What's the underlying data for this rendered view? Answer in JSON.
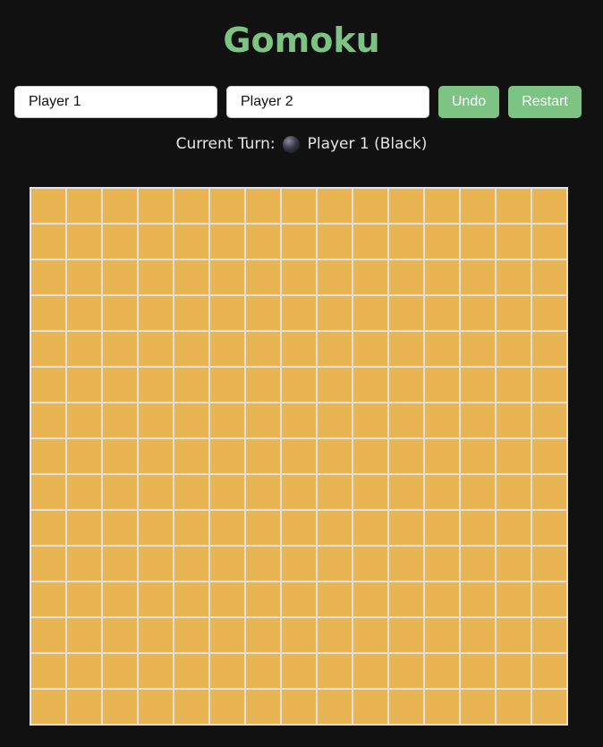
{
  "title": "Gomoku",
  "players": {
    "player1": {
      "value": "Player 1"
    },
    "player2": {
      "value": "Player 2"
    }
  },
  "buttons": {
    "undo": "Undo",
    "restart": "Restart"
  },
  "turn": {
    "label": "Current Turn:",
    "stone_color": "black",
    "player_text": "Player 1 (Black)"
  },
  "board": {
    "columns": 15,
    "rows": 15,
    "stones": [],
    "board_color": "#e9b452",
    "line_color": "#e2e2e2"
  },
  "colors": {
    "accent": "#7dc384",
    "background": "#111111"
  }
}
